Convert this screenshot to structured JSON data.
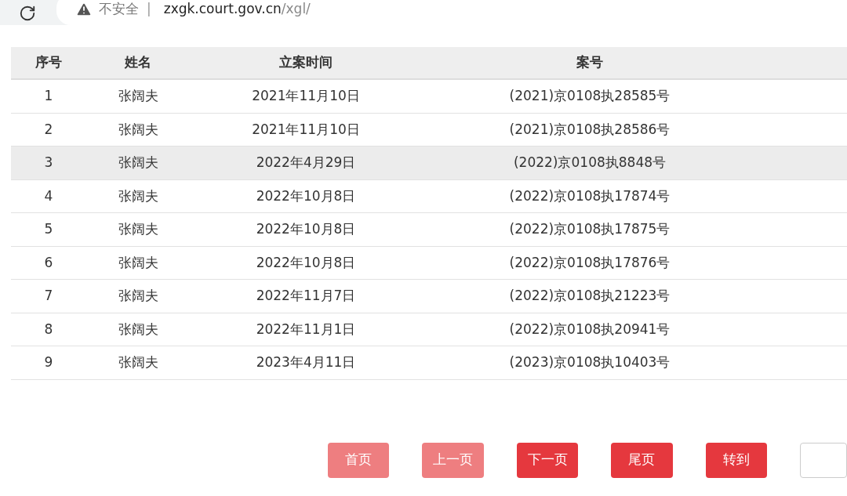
{
  "browser": {
    "security": "不安全",
    "separator": "|",
    "url_host": "zxgk.court.gov.cn",
    "url_path": "/xgl/"
  },
  "table": {
    "columns": [
      "序号",
      "姓名",
      "立案时间",
      "案号"
    ],
    "rows": [
      {
        "cells": [
          "1",
          "张阔夫",
          "2021年11月10日",
          "(2021)京0108执28585号"
        ],
        "highlighted": false
      },
      {
        "cells": [
          "2",
          "张阔夫",
          "2021年11月10日",
          "(2021)京0108执28586号"
        ],
        "highlighted": false
      },
      {
        "cells": [
          "3",
          "张阔夫",
          "2022年4月29日",
          "(2022)京0108执8848号"
        ],
        "highlighted": true
      },
      {
        "cells": [
          "4",
          "张阔夫",
          "2022年10月8日",
          "(2022)京0108执17874号"
        ],
        "highlighted": false
      },
      {
        "cells": [
          "5",
          "张阔夫",
          "2022年10月8日",
          "(2022)京0108执17875号"
        ],
        "highlighted": false
      },
      {
        "cells": [
          "6",
          "张阔夫",
          "2022年10月8日",
          "(2022)京0108执17876号"
        ],
        "highlighted": false
      },
      {
        "cells": [
          "7",
          "张阔夫",
          "2022年11月7日",
          "(2022)京0108执21223号"
        ],
        "highlighted": false
      },
      {
        "cells": [
          "8",
          "张阔夫",
          "2022年11月1日",
          "(2022)京0108执20941号"
        ],
        "highlighted": false
      },
      {
        "cells": [
          "9",
          "张阔夫",
          "2023年4月11日",
          "(2023)京0108执10403号"
        ],
        "highlighted": false
      }
    ]
  },
  "pagination": {
    "buttons": [
      {
        "label": "首页",
        "disabled": true
      },
      {
        "label": "上一页",
        "disabled": true
      },
      {
        "label": "下一页",
        "disabled": false
      },
      {
        "label": "尾页",
        "disabled": false
      },
      {
        "label": "转到",
        "disabled": false
      }
    ]
  }
}
